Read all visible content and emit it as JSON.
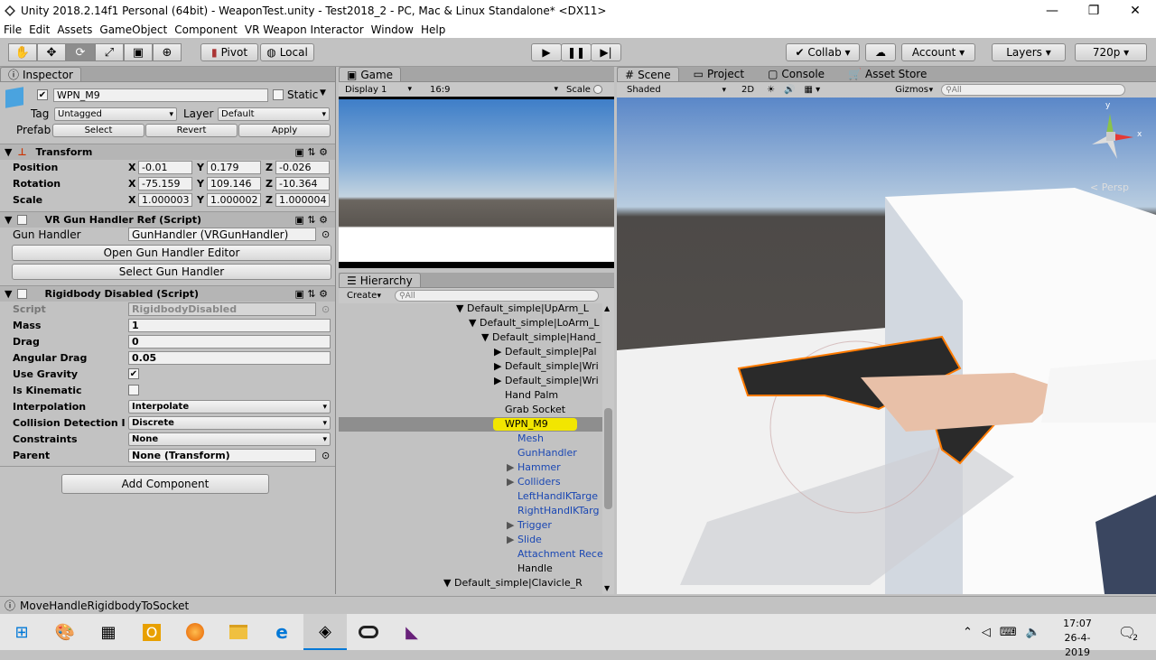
{
  "window": {
    "title": "Unity 2018.2.14f1 Personal (64bit) - WeaponTest.unity - Test2018_2 - PC, Mac & Linux Standalone* <DX11>"
  },
  "menu": [
    "File",
    "Edit",
    "Assets",
    "GameObject",
    "Component",
    "VR Weapon Interactor",
    "Window",
    "Help"
  ],
  "toolbar": {
    "pivot": "Pivot",
    "local": "Local",
    "collab": "Collab",
    "account": "Account",
    "layers": "Layers",
    "resolution": "720p"
  },
  "inspector": {
    "tab": "Inspector",
    "object_name": "WPN_M9",
    "static_label": "Static",
    "tag_label": "Tag",
    "tag_value": "Untagged",
    "layer_label": "Layer",
    "layer_value": "Default",
    "prefab_label": "Prefab",
    "prefab_select": "Select",
    "prefab_revert": "Revert",
    "prefab_apply": "Apply",
    "transform": {
      "title": "Transform",
      "position": {
        "label": "Position",
        "x": "-0.01",
        "y": "0.179",
        "z": "-0.026"
      },
      "rotation": {
        "label": "Rotation",
        "x": "-75.159",
        "y": "109.146",
        "z": "-10.364"
      },
      "scale": {
        "label": "Scale",
        "x": "1.000003",
        "y": "1.000002",
        "z": "1.000004"
      }
    },
    "gunref": {
      "title": "VR Gun Handler Ref (Script)",
      "field_label": "Gun Handler",
      "field_value": "GunHandler (VRGunHandler)",
      "open_btn": "Open Gun Handler Editor",
      "select_btn": "Select Gun Handler"
    },
    "rigid": {
      "title": "Rigidbody Disabled (Script)",
      "script_label": "Script",
      "script_value": "RigidbodyDisabled",
      "mass_label": "Mass",
      "mass": "1",
      "drag_label": "Drag",
      "drag": "0",
      "adrag_label": "Angular Drag",
      "adrag": "0.05",
      "gravity_label": "Use Gravity",
      "kinematic_label": "Is Kinematic",
      "interp_label": "Interpolation",
      "interp": "Interpolate",
      "collision_label": "Collision Detection I",
      "collision": "Discrete",
      "constraints_label": "Constraints",
      "constraints": "None",
      "parent_label": "Parent",
      "parent": "None (Transform)"
    },
    "add_component": "Add Component"
  },
  "game": {
    "tab": "Game",
    "display": "Display 1",
    "aspect": "16:9",
    "scale": "Scale"
  },
  "hierarchy": {
    "tab": "Hierarchy",
    "create": "Create",
    "search_placeholder": "All",
    "rows": [
      {
        "label": "Default_simple|UpArm_L"
      },
      {
        "label": "Default_simple|LoArm_L"
      },
      {
        "label": "Default_simple|Hand_"
      },
      {
        "label": "Default_simple|Pal"
      },
      {
        "label": "Default_simple|Wri"
      },
      {
        "label": "Default_simple|Wri"
      },
      {
        "label": "Hand Palm"
      },
      {
        "label": "Grab Socket"
      },
      {
        "label": "WPN_M9"
      },
      {
        "label": "Mesh"
      },
      {
        "label": "GunHandler"
      },
      {
        "label": "Hammer"
      },
      {
        "label": "Colliders"
      },
      {
        "label": "LeftHandIKTarge"
      },
      {
        "label": "RightHandIKTarg"
      },
      {
        "label": "Trigger"
      },
      {
        "label": "Slide"
      },
      {
        "label": "Attachment Rece"
      },
      {
        "label": "Handle"
      },
      {
        "label": "Default_simple|Clavicle_R"
      }
    ]
  },
  "scene": {
    "tabs": [
      "Scene",
      "Project",
      "Console",
      "Asset Store"
    ],
    "shaded": "Shaded",
    "mode2d": "2D",
    "gizmos": "Gizmos",
    "search_placeholder": "All",
    "persp": "Persp",
    "axes": {
      "y": "y",
      "x": "x"
    }
  },
  "status": {
    "message": "MoveHandleRigidbodyToSocket"
  },
  "taskbar": {
    "time": "17:07",
    "date": "26-4-2019",
    "notifications": "2"
  },
  "colors": {
    "selection": "#f2e600",
    "link": "#1a47b3",
    "panel": "#c2c2c2"
  }
}
